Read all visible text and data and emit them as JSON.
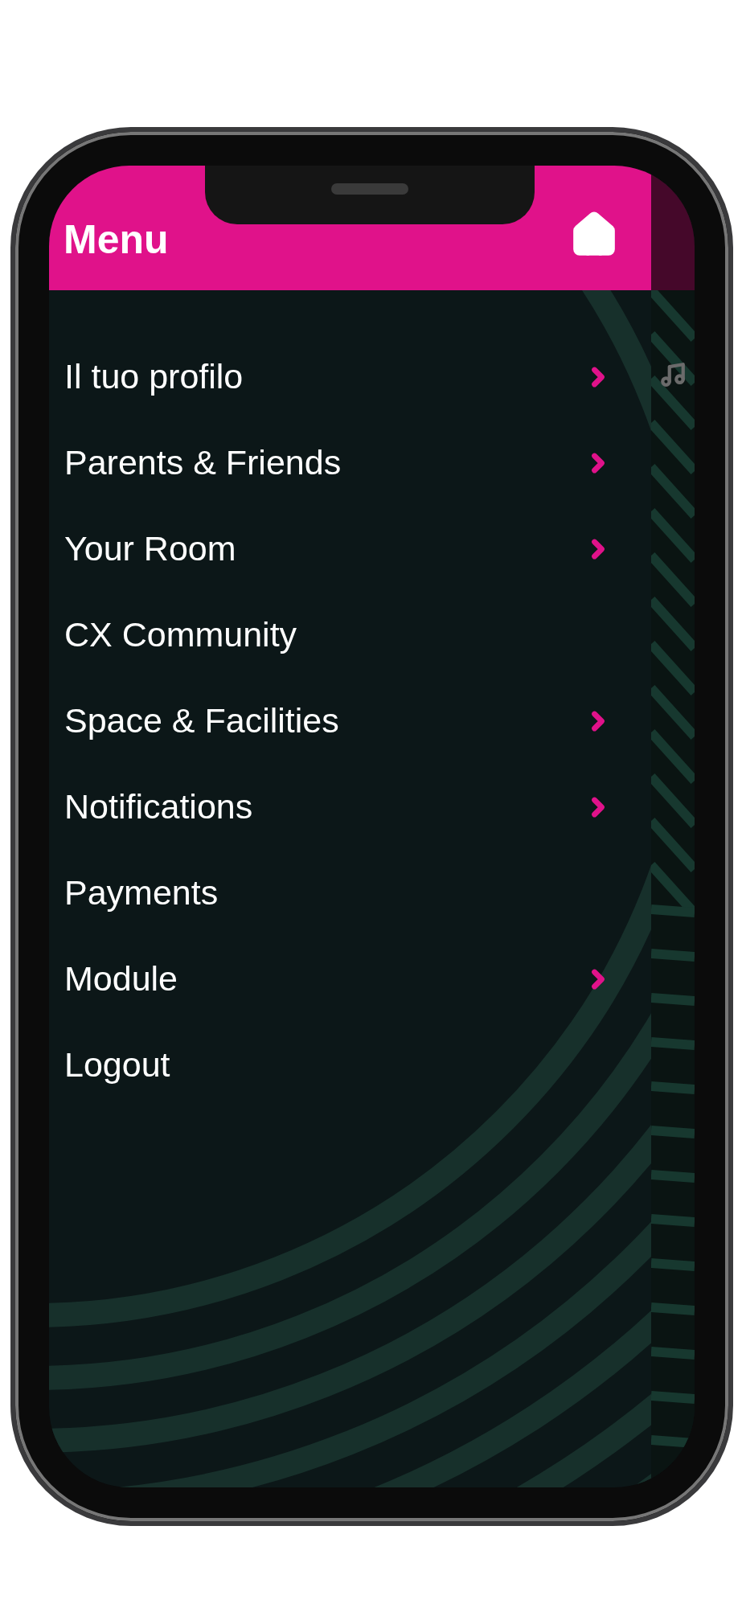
{
  "header": {
    "title": "Menu"
  },
  "menu_items": [
    {
      "label": "Il tuo profilo",
      "has_submenu": true
    },
    {
      "label": "Parents & Friends",
      "has_submenu": true
    },
    {
      "label": "Your Room",
      "has_submenu": true
    },
    {
      "label": "CX Community",
      "has_submenu": false
    },
    {
      "label": "Space & Facilities",
      "has_submenu": true
    },
    {
      "label": "Notifications",
      "has_submenu": true
    },
    {
      "label": "Payments",
      "has_submenu": false
    },
    {
      "label": "Module",
      "has_submenu": true
    },
    {
      "label": "Logout",
      "has_submenu": false
    }
  ]
}
